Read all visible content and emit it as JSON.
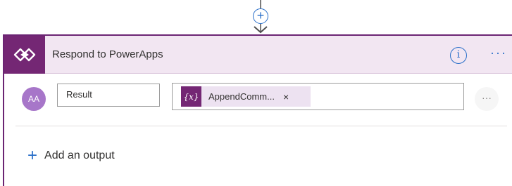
{
  "connector": {
    "insert_symbol": "+"
  },
  "card": {
    "title": "Respond to PowerApps",
    "app_icon": "powerapps-icon",
    "info_symbol": "i",
    "more_symbol": "···",
    "accent_color": "#742774",
    "header_bg": "#f2e6f2"
  },
  "output_row": {
    "avatar_text": "AA",
    "name_value": "Result",
    "token": {
      "icon_text": "{x}",
      "label": "AppendComm...",
      "remove_symbol": "×"
    },
    "more_symbol": "···"
  },
  "add_output": {
    "plus_symbol": "+",
    "label": "Add an output"
  }
}
